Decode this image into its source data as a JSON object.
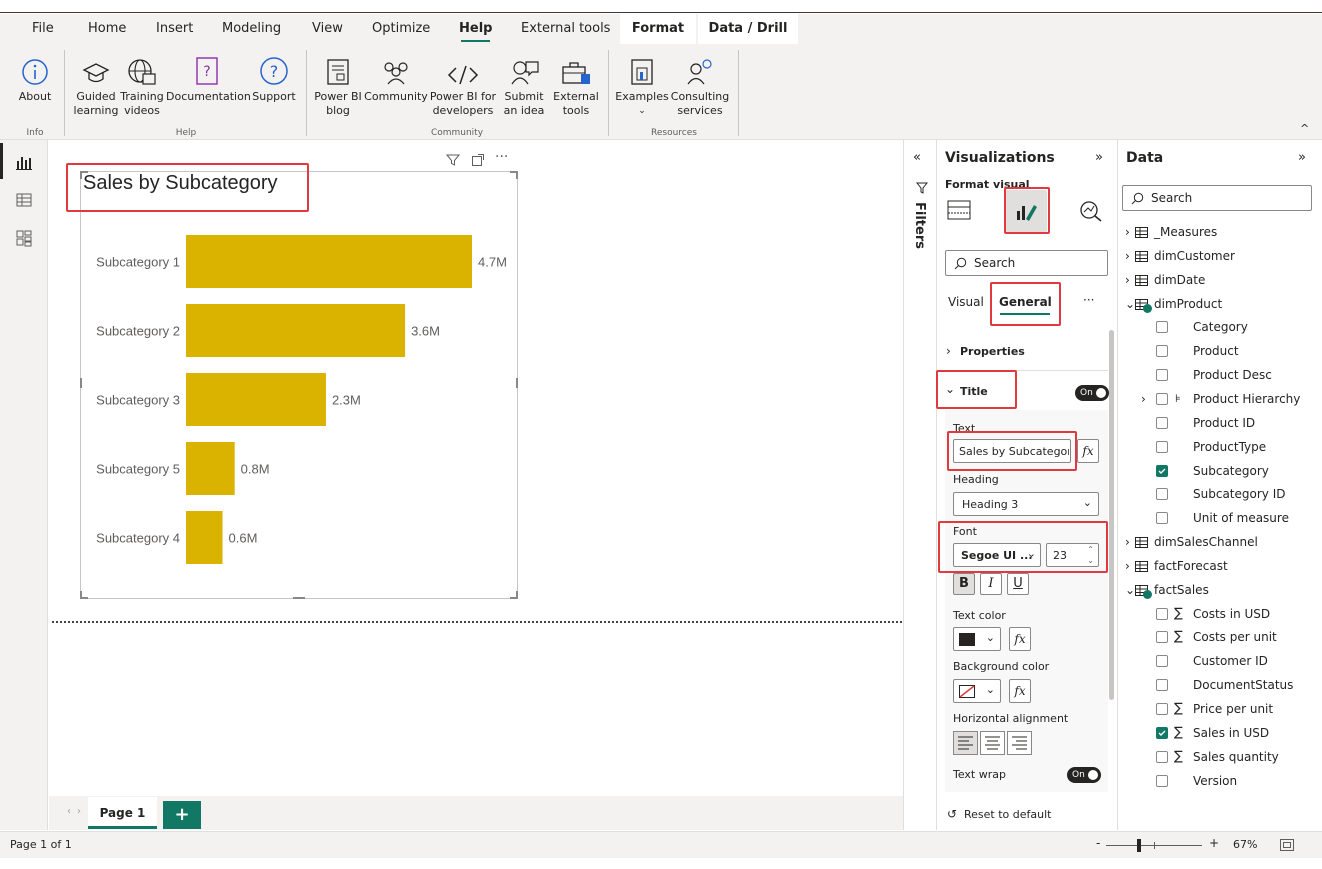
{
  "ribbon": {
    "tabs": [
      "File",
      "Home",
      "Insert",
      "Modeling",
      "View",
      "Optimize",
      "Help",
      "External tools",
      "Format",
      "Data / Drill"
    ],
    "active_tab": "Help",
    "buttons": {
      "about": "About",
      "guided_learning": "Guided learning",
      "training_videos": "Training videos",
      "documentation": "Documentation",
      "support": "Support",
      "pbi_blog": "Power BI blog",
      "community": "Community",
      "pbi_developers": "Power BI for developers",
      "submit_idea": "Submit an idea",
      "external_tools": "External tools",
      "examples": "Examples",
      "consulting": "Consulting services"
    },
    "groups": {
      "info": "Info",
      "help": "Help",
      "community": "Community",
      "resources": "Resources"
    }
  },
  "chart": {
    "title": "Sales by Subcategory"
  },
  "chart_data": {
    "type": "bar",
    "orientation": "horizontal",
    "title": "Sales by Subcategory",
    "categories": [
      "Subcategory 1",
      "Subcategory 2",
      "Subcategory 3",
      "Subcategory 5",
      "Subcategory 4"
    ],
    "values": [
      4.7,
      3.6,
      2.3,
      0.8,
      0.6
    ],
    "data_labels": [
      "4.7M",
      "3.6M",
      "2.3M",
      "0.8M",
      "0.6M"
    ],
    "xlim": [
      0,
      4.7
    ],
    "grid": false,
    "bar_color": "#d9b300"
  },
  "pages": {
    "tab_label": "Page 1",
    "add_label": "+",
    "status": "Page 1 of 1",
    "zoom_minus": "-",
    "zoom_plus": "+",
    "zoom": "67%"
  },
  "filters": {
    "label": "Filters"
  },
  "viz": {
    "title": "Visualizations",
    "format_visual": "Format visual",
    "search_placeholder": "Search",
    "tab_visual": "Visual",
    "tab_general": "General",
    "more": "···",
    "properties": "Properties",
    "title_section": "Title",
    "toggle_on": "On",
    "text_label": "Text",
    "text_value": "Sales by Subcategor",
    "fx": "fx",
    "heading_label": "Heading",
    "heading_value": "Heading 3",
    "font_label": "Font",
    "font_value": "Segoe UI ...",
    "font_size": "23",
    "bold": "B",
    "italic": "I",
    "underline": "U",
    "text_color_label": "Text color",
    "bg_color_label": "Background color",
    "halign_label": "Horizontal alignment",
    "wrap_label": "Text wrap",
    "reset": "Reset to default"
  },
  "data": {
    "title": "Data",
    "search_placeholder": "Search",
    "items": [
      {
        "label": "_Measures",
        "kind": "table"
      },
      {
        "label": "dimCustomer",
        "kind": "table"
      },
      {
        "label": "dimDate",
        "kind": "table"
      },
      {
        "label": "dimProduct",
        "kind": "table-open"
      },
      {
        "label": "Category",
        "kind": "field",
        "checked": false
      },
      {
        "label": "Product",
        "kind": "field",
        "checked": false
      },
      {
        "label": "Product Desc",
        "kind": "field",
        "checked": false
      },
      {
        "label": "Product Hierarchy",
        "kind": "hierarchy",
        "checked": false
      },
      {
        "label": "Product ID",
        "kind": "field",
        "checked": false
      },
      {
        "label": "ProductType",
        "kind": "field",
        "checked": false
      },
      {
        "label": "Subcategory",
        "kind": "field",
        "checked": true
      },
      {
        "label": "Subcategory ID",
        "kind": "field",
        "checked": false
      },
      {
        "label": "Unit of measure",
        "kind": "field",
        "checked": false
      },
      {
        "label": "dimSalesChannel",
        "kind": "table"
      },
      {
        "label": "factForecast",
        "kind": "table"
      },
      {
        "label": "factSales",
        "kind": "table-open"
      },
      {
        "label": "Costs in USD",
        "kind": "measure",
        "checked": false
      },
      {
        "label": "Costs per unit",
        "kind": "measure",
        "checked": false
      },
      {
        "label": "Customer ID",
        "kind": "field",
        "checked": false
      },
      {
        "label": "DocumentStatus",
        "kind": "field",
        "checked": false
      },
      {
        "label": "Price per unit",
        "kind": "measure",
        "checked": false
      },
      {
        "label": "Sales in USD",
        "kind": "measure",
        "checked": true
      },
      {
        "label": "Sales quantity",
        "kind": "measure",
        "checked": false
      },
      {
        "label": "Version",
        "kind": "field",
        "checked": false
      }
    ]
  }
}
